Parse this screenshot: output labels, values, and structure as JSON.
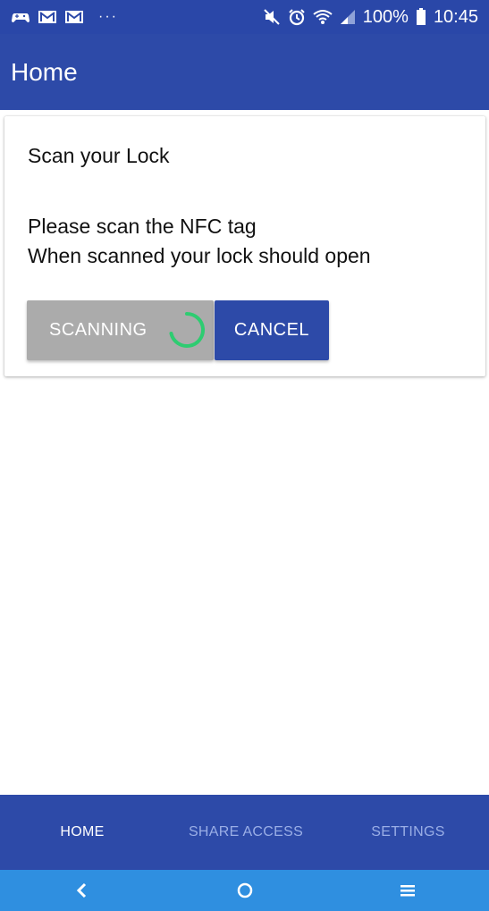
{
  "status_bar": {
    "left_icons": [
      "game-controller-icon",
      "mail-icon",
      "mail-icon"
    ],
    "overflow": "···",
    "battery": "100%",
    "time": "10:45"
  },
  "app_bar": {
    "title": "Home"
  },
  "card": {
    "title": "Scan your Lock",
    "line1": "Please scan the NFC tag",
    "line2": "When scanned your lock should open",
    "scanning_label": "SCANNING",
    "cancel_label": "CANCEL"
  },
  "bottom_nav": {
    "tabs": [
      {
        "label": "HOME",
        "active": true
      },
      {
        "label": "SHARE ACCESS",
        "active": false
      },
      {
        "label": "SETTINGS",
        "active": false
      }
    ]
  },
  "colors": {
    "primary": "#2d4aa8",
    "status_bar": "#2a47a8",
    "system_nav": "#2f8fe0",
    "scanning_button": "#ababab",
    "spinner": "#2ecc71",
    "inactive_tab": "#9aaee6"
  }
}
